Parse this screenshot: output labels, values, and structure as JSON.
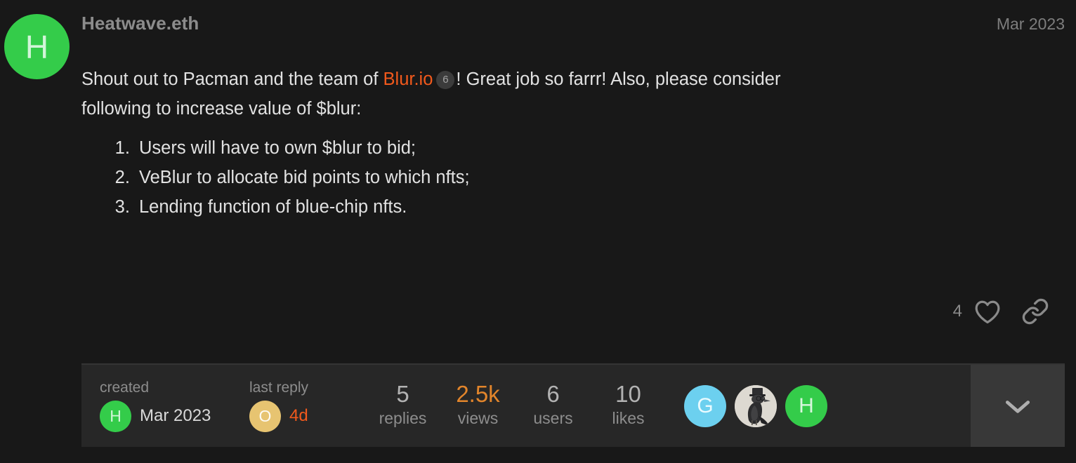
{
  "post": {
    "author": {
      "name": "Heatwave.eth",
      "avatar_letter": "H",
      "avatar_color": "#34cc4a"
    },
    "date": "Mar 2023",
    "body": {
      "paragraph_part1": "Shout out to Pacman and the team of ",
      "link_text": "Blur.io",
      "link_badge": "6",
      "paragraph_part2": "! Great job so farrr! Also, please consider following to increase value of $blur:",
      "list": [
        "Users will have to own $blur to bid;",
        "VeBlur to allocate bid points to which nfts;",
        "Lending function of blue-chip nfts."
      ]
    },
    "actions": {
      "like_count": "4",
      "like_icon": "heart-icon",
      "share_icon": "link-icon"
    }
  },
  "summary": {
    "created": {
      "label": "created",
      "avatar_letter": "H",
      "avatar_color": "#34cc4a",
      "date": "Mar 2023"
    },
    "last_reply": {
      "label": "last reply",
      "avatar_letter": "O",
      "avatar_color": "#e7c471",
      "date": "4d"
    },
    "stats": [
      {
        "number": "5",
        "label": "replies",
        "highlight": false
      },
      {
        "number": "2.5k",
        "label": "views",
        "highlight": true
      },
      {
        "number": "6",
        "label": "users",
        "highlight": false
      },
      {
        "number": "10",
        "label": "likes",
        "highlight": false
      }
    ],
    "participants": [
      {
        "letter": "G",
        "type": "letter",
        "color": "#6cd0ef"
      },
      {
        "letter": "",
        "type": "photo",
        "color": "#ddd9d1",
        "description": "crow-with-top-hat-avatar"
      },
      {
        "letter": "H",
        "type": "letter",
        "color": "#34cc4a"
      }
    ],
    "expand_icon": "chevron-down-icon"
  },
  "colors": {
    "page_background": "#181818",
    "summary_background": "#272727",
    "expand_background": "#383838",
    "accent_orange": "#f1591c",
    "views_orange": "#e2852b",
    "body_text": "#e2e2e2",
    "muted_text": "#8d8d8d"
  }
}
